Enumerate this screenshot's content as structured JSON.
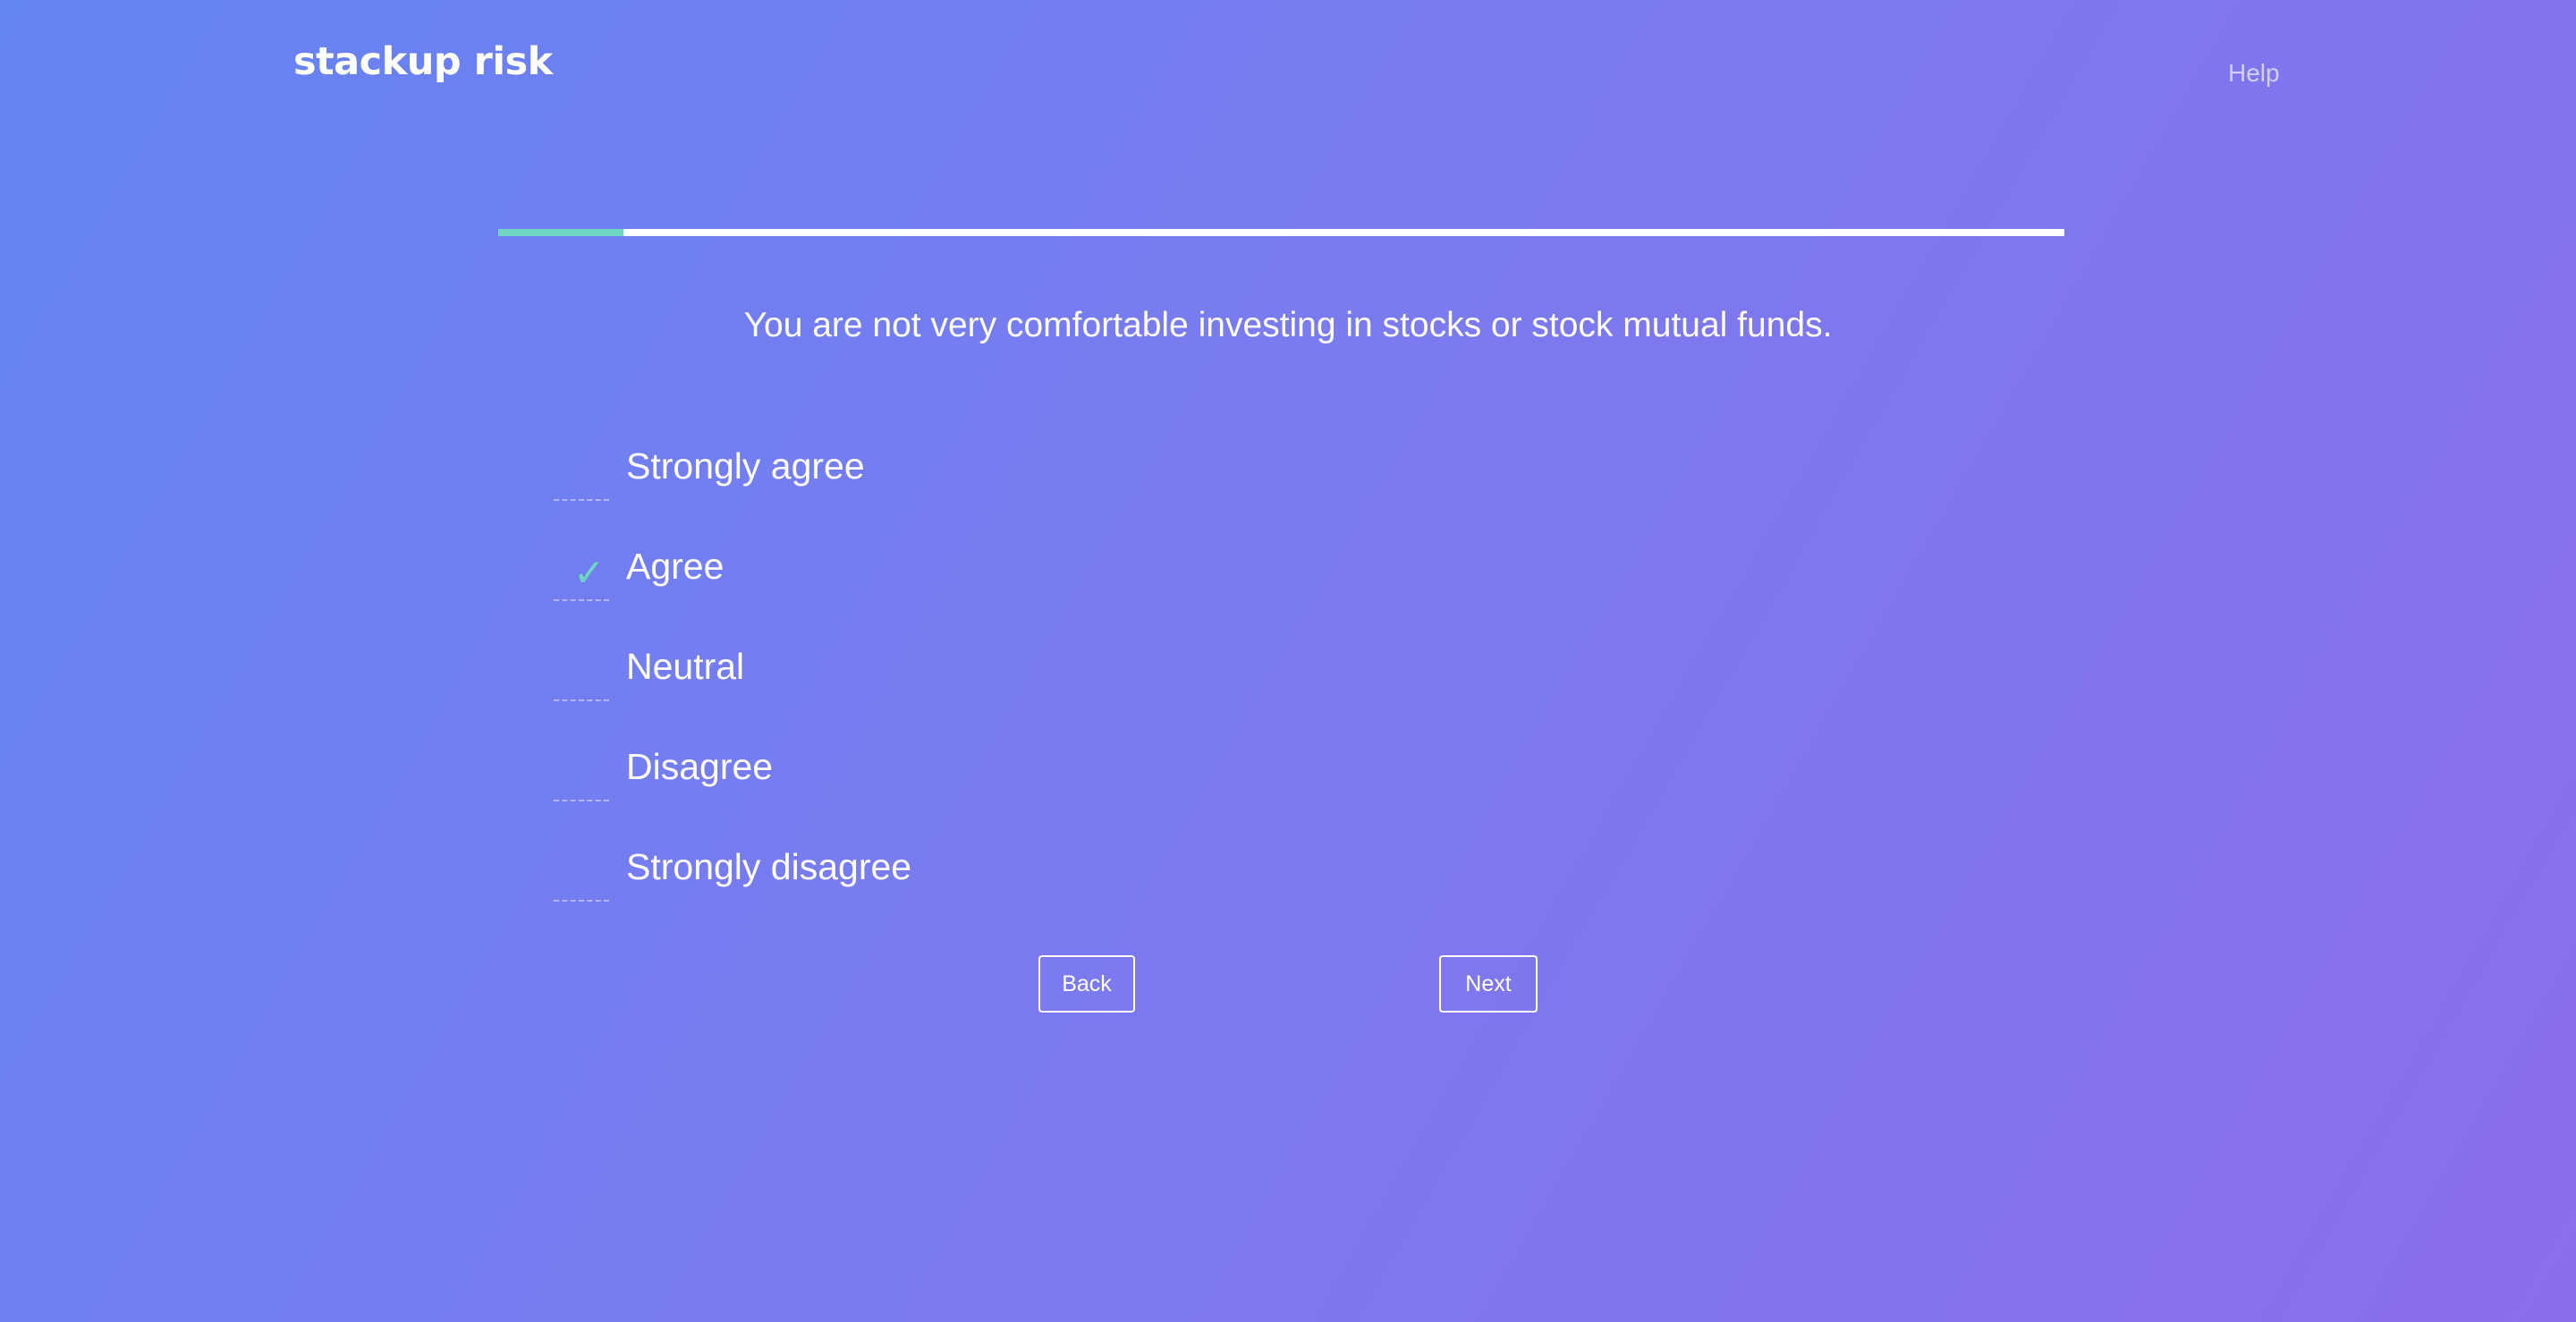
{
  "header": {
    "logo_text": "stackup risk",
    "help_label": "Help"
  },
  "progress": {
    "fraction": 0.08,
    "fill_color": "#6fd6c4",
    "track_color": "#ffffff"
  },
  "question": {
    "text": "You are not very comfortable investing in stocks or stock mutual funds."
  },
  "options": [
    {
      "label": "Strongly agree",
      "selected": false
    },
    {
      "label": "Agree",
      "selected": true
    },
    {
      "label": "Neutral",
      "selected": false
    },
    {
      "label": "Disagree",
      "selected": false
    },
    {
      "label": "Strongly disagree",
      "selected": false
    }
  ],
  "check_glyph": "✓",
  "check_icon": "checkmark-icon",
  "buttons": {
    "back_label": "Back",
    "next_label": "Next"
  },
  "colors": {
    "background_start": "#6484f2",
    "background_end": "#8a6deb",
    "accent": "#6fd6c4"
  }
}
